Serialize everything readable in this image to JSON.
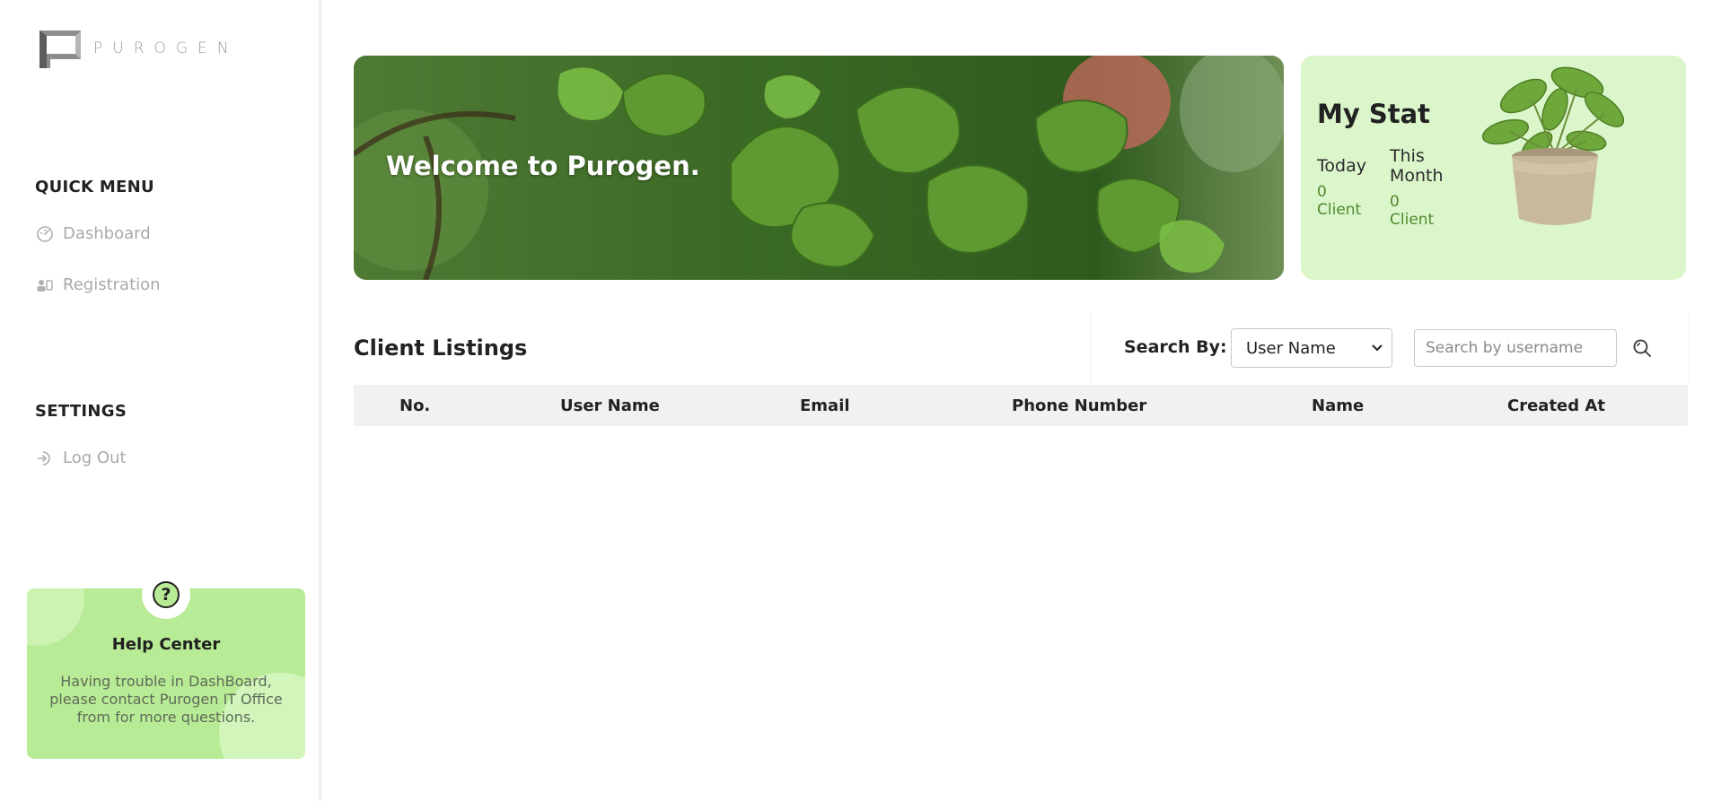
{
  "brand": {
    "name": "PUROGEN"
  },
  "sidebar": {
    "quick_menu_title": "QUICK MENU",
    "quick_menu": [
      {
        "label": "Dashboard",
        "icon": "dashboard-gauge-icon"
      },
      {
        "label": "Registration",
        "icon": "registration-icon"
      }
    ],
    "settings_title": "SETTINGS",
    "settings": [
      {
        "label": "Log Out",
        "icon": "logout-icon"
      }
    ]
  },
  "help_center": {
    "icon": "question-mark-icon",
    "title": "Help Center",
    "text": "Having trouble in DashBoard, please contact Purogen IT Office from for more questions."
  },
  "banner": {
    "title": "Welcome to Purogen."
  },
  "stat": {
    "title": "My Stat",
    "today_label": "Today",
    "today_value": "0 Client",
    "month_label": "This Month",
    "month_value": "0 Client"
  },
  "listings": {
    "title": "Client Listings",
    "search_by_label": "Search By:",
    "search_by_selected": "User Name",
    "search_placeholder": "Search by username",
    "columns": [
      "No.",
      "User Name",
      "Email",
      "Phone Number",
      "Name",
      "Created At"
    ],
    "rows": []
  },
  "colors": {
    "accent_green": "#b8eb95",
    "stat_bg": "#dcf6cc",
    "stat_value": "#4f8a2f"
  }
}
